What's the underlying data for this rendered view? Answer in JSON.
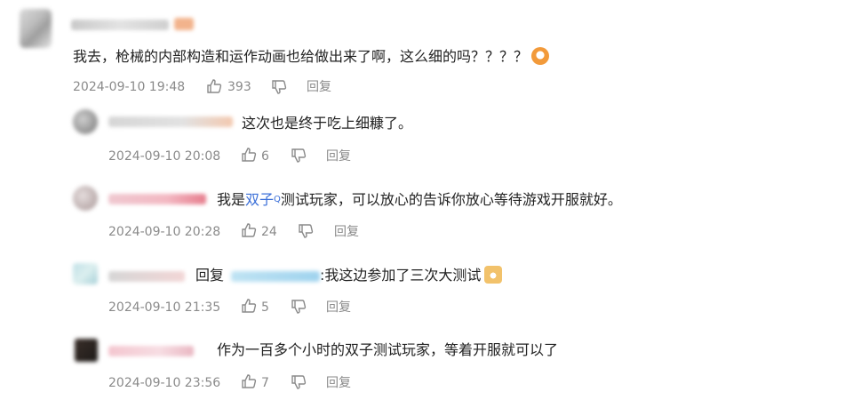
{
  "main_comment": {
    "text": "我去，枪械的内部构造和运作动画也给做出来了啊，这么细的吗？？？？",
    "time": "2024-09-10 19:48",
    "likes": "393",
    "reply_label": "回复"
  },
  "replies": [
    {
      "text": "这次也是终于吃上细糠了。",
      "time": "2024-09-10 20:08",
      "likes": "6",
      "reply_label": "回复"
    },
    {
      "text_prefix": "我是",
      "topic": "双子",
      "topic_mark": "Q",
      "text_suffix": "测试玩家，可以放心的告诉你放心等待游戏开服就好。",
      "time": "2024-09-10 20:28",
      "likes": "24",
      "reply_label": "回复"
    },
    {
      "reply_to_prefix": "回复",
      "text": ":我这边参加了三次大测试",
      "time": "2024-09-10 21:35",
      "likes": "5",
      "reply_label": "回复"
    },
    {
      "text": "作为一百多个小时的双子测试玩家，等着开服就可以了",
      "time": "2024-09-10 23:56",
      "likes": "7",
      "reply_label": "回复"
    }
  ],
  "icons": {
    "like": "thumbs-up-icon",
    "dislike": "thumbs-down-icon"
  },
  "colors": {
    "meta_text": "#8a8a8a",
    "topic_link": "#3b6fd8",
    "main_text": "#222222"
  }
}
